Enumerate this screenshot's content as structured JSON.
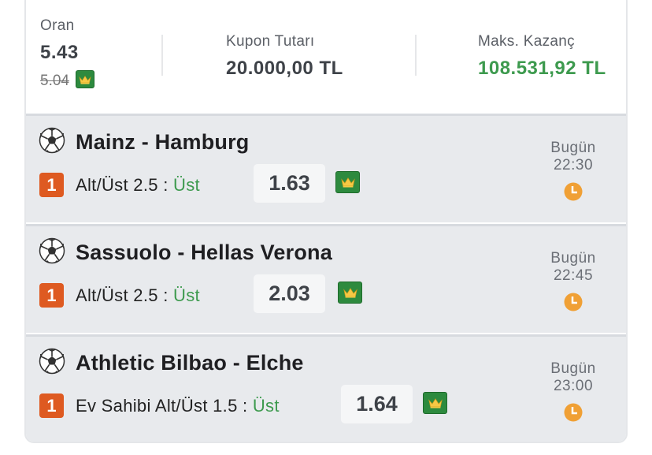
{
  "summary": {
    "odds_label": "Oran",
    "odds_value": "5.43",
    "odds_old": "5.04",
    "coupon_label": "Kupon Tutarı",
    "coupon_value": "20.000,00 TL",
    "max_win_label": "Maks. Kazanç",
    "max_win_value": "108.531,92 TL"
  },
  "matches": [
    {
      "teams": "Mainz - Hamburg",
      "badge": "1",
      "market": "Alt/Üst 2.5 : ",
      "pick": "Üst",
      "odds": "1.63",
      "day": "Bugün",
      "time": "22:30"
    },
    {
      "teams": "Sassuolo - Hellas Verona",
      "badge": "1",
      "market": "Alt/Üst 2.5 : ",
      "pick": "Üst",
      "odds": "2.03",
      "day": "Bugün",
      "time": "22:45"
    },
    {
      "teams": "Athletic Bilbao - Elche",
      "badge": "1",
      "market": "Ev Sahibi Alt/Üst 1.5 : ",
      "pick": "Üst",
      "odds": "1.64",
      "day": "Bugün",
      "time": "23:00"
    }
  ],
  "icons": {
    "sport": "soccer-ball-icon",
    "boost": "crown-icon",
    "kickoff": "clock-icon"
  },
  "colors": {
    "accent_green": "#3d9a4e",
    "badge_orange": "#de5a21",
    "crown_green": "#2d8a3e",
    "clock_orange": "#f0a035"
  }
}
